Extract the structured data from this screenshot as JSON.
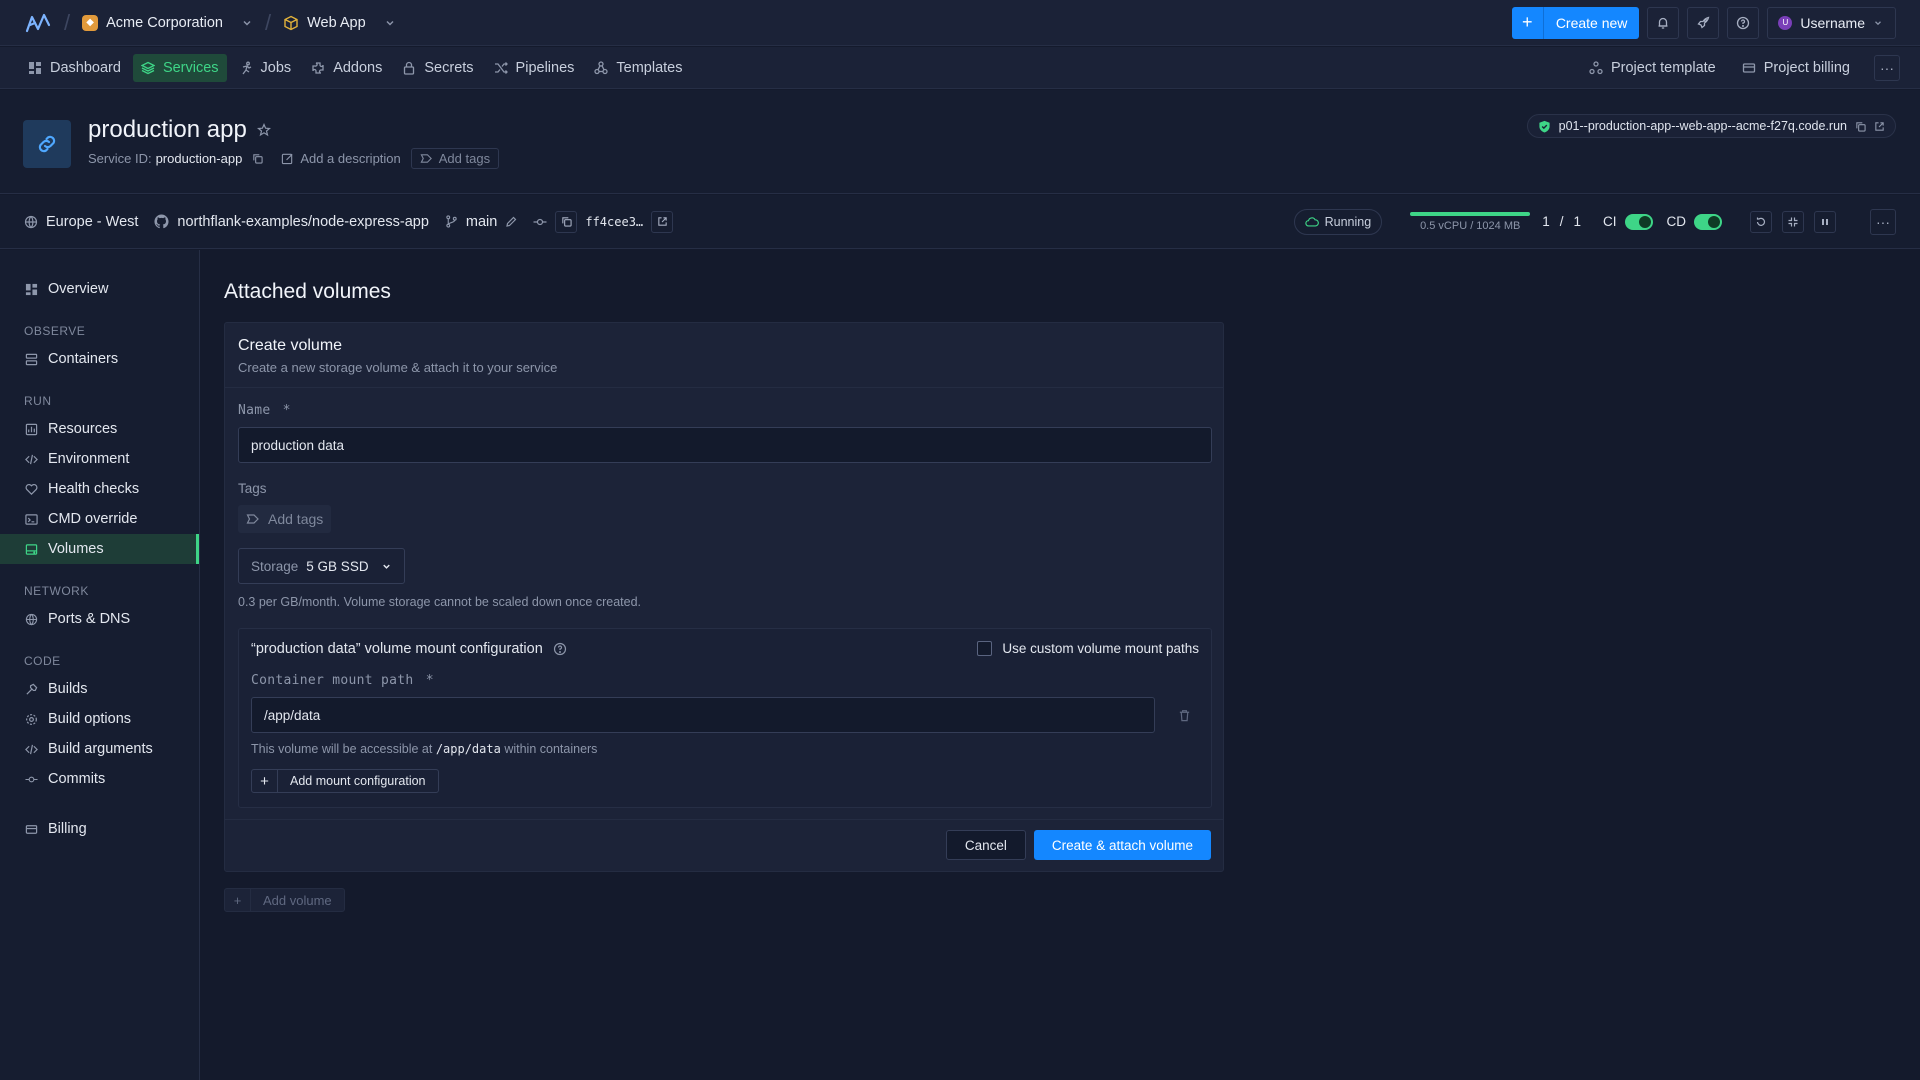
{
  "topbar": {
    "org_name": "Acme Corporation",
    "project_name": "Web App",
    "create_new_label": "Create new",
    "username": "Username",
    "avatar_letter": "U"
  },
  "nav": {
    "items": [
      {
        "label": "Dashboard",
        "icon": "dashboard-icon"
      },
      {
        "label": "Services",
        "icon": "services-icon"
      },
      {
        "label": "Jobs",
        "icon": "jobs-icon"
      },
      {
        "label": "Addons",
        "icon": "addons-icon"
      },
      {
        "label": "Secrets",
        "icon": "lock-icon"
      },
      {
        "label": "Pipelines",
        "icon": "pipelines-icon"
      },
      {
        "label": "Templates",
        "icon": "templates-icon"
      }
    ],
    "active": "Services",
    "project_template": "Project template",
    "project_billing": "Project billing",
    "more": "···"
  },
  "service": {
    "name": "production app",
    "id_label": "Service ID:",
    "id_value": "production-app",
    "add_description": "Add a description",
    "add_tags": "Add tags",
    "url": "p01--production-app--web-app--acme-f27q.code.run"
  },
  "infobar": {
    "region": "Europe - West",
    "repo": "northflank-examples/node-express-app",
    "branch": "main",
    "commit": "ff4cee3…",
    "status": "Running",
    "resources": "0.5 vCPU / 1024 MB",
    "resource_usage_fraction": 1.0,
    "instances_running": "1",
    "instances_sep": "/",
    "instances_total": "1",
    "ci_label": "CI",
    "cd_label": "CD",
    "ci_enabled": true,
    "cd_enabled": true,
    "more": "···"
  },
  "sidebar": {
    "overview": "Overview",
    "observe_heading": "OBSERVE",
    "containers": "Containers",
    "run_heading": "RUN",
    "resources": "Resources",
    "environment": "Environment",
    "health_checks": "Health checks",
    "cmd_override": "CMD override",
    "volumes": "Volumes",
    "network_heading": "NETWORK",
    "ports_dns": "Ports & DNS",
    "code_heading": "CODE",
    "builds": "Builds",
    "build_options": "Build options",
    "build_arguments": "Build arguments",
    "commits": "Commits",
    "billing": "Billing"
  },
  "main": {
    "title": "Attached volumes",
    "card": {
      "title": "Create volume",
      "description": "Create a new storage volume & attach it to your service",
      "name_label": "Name",
      "required_mark": "*",
      "name_value": "production data",
      "tags_label": "Tags",
      "add_tags": "Add tags",
      "storage_label": "Storage",
      "storage_value": "5 GB SSD",
      "storage_hint": "0.3 per GB/month. Volume storage cannot be scaled down once created.",
      "mount": {
        "title": "“production data” volume mount configuration",
        "custom_paths_label": "Use custom volume mount paths",
        "custom_paths_checked": false,
        "path_label": "Container mount path",
        "path_value": "/app/data",
        "hint_prefix": "This volume will be accessible at",
        "hint_path": "/app/data",
        "hint_suffix": "within containers",
        "add_mount": "Add mount configuration"
      },
      "cancel": "Cancel",
      "submit": "Create & attach volume"
    },
    "add_volume": "Add volume"
  },
  "colors": {
    "accent": "#1487ff",
    "success": "#3ed587",
    "background": "#141a2c"
  }
}
